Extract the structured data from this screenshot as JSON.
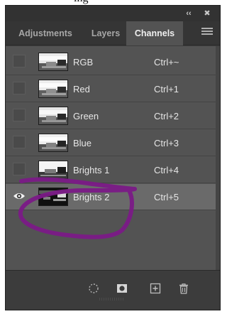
{
  "page": {
    "heading_fragment": "ing"
  },
  "panel": {
    "title_bar": {
      "collapse_glyph": "‹‹",
      "close_glyph": "✖"
    },
    "tabs": [
      {
        "label": "Adjustments",
        "active": false
      },
      {
        "label": "Layers",
        "active": false
      },
      {
        "label": "Channels",
        "active": true
      }
    ],
    "channels": [
      {
        "name": "RGB",
        "shortcut": "Ctrl+~",
        "visible": false,
        "selected": false
      },
      {
        "name": "Red",
        "shortcut": "Ctrl+1",
        "visible": false,
        "selected": false
      },
      {
        "name": "Green",
        "shortcut": "Ctrl+2",
        "visible": false,
        "selected": false
      },
      {
        "name": "Blue",
        "shortcut": "Ctrl+3",
        "visible": false,
        "selected": false
      },
      {
        "name": "Brights 1",
        "shortcut": "Ctrl+4",
        "visible": false,
        "selected": false
      },
      {
        "name": "Brights 2",
        "shortcut": "Ctrl+5",
        "visible": true,
        "selected": true
      }
    ],
    "bottom_tools": [
      "load-channel-as-selection-icon",
      "save-selection-as-channel-icon",
      "new-channel-icon",
      "delete-channel-icon"
    ]
  },
  "colors": {
    "panel_bg": "#535353",
    "active_tab": "#535353",
    "selected_row": "#6a6a6a",
    "annotation_stroke": "#7b1b86"
  }
}
